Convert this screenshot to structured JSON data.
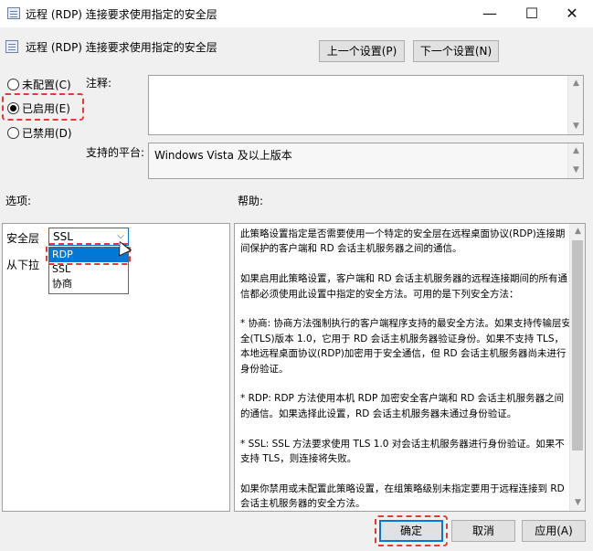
{
  "window": {
    "title": "远程 (RDP) 连接要求使用指定的安全层",
    "minimize": "—",
    "maximize": "☐",
    "close": "✕"
  },
  "policy": {
    "title": "远程 (RDP) 连接要求使用指定的安全层",
    "prev_button": "上一个设置(P)",
    "next_button": "下一个设置(N)"
  },
  "state": {
    "options": [
      {
        "label": "未配置(C)",
        "checked": false
      },
      {
        "label": "已启用(E)",
        "checked": true
      },
      {
        "label": "已禁用(D)",
        "checked": false
      }
    ]
  },
  "comment": {
    "label": "注释:",
    "value": ""
  },
  "platform": {
    "label": "支持的平台:",
    "value": "Windows Vista 及以上版本"
  },
  "options_panel": {
    "header": "选项:",
    "field_label": "安全层",
    "select_value": "SSL",
    "dropdown_options": [
      "RDP",
      "SSL",
      "协商"
    ],
    "highlighted_option": "RDP",
    "truncated_text": "从下拉"
  },
  "help_panel": {
    "header": "帮助:",
    "paragraphs": [
      "此策略设置指定是否需要使用一个特定的安全层在远程桌面协议(RDP)连接期间保护的客户端和 RD 会话主机服务器之间的通信。",
      "如果启用此策略设置，客户端和 RD 会话主机服务器的远程连接期间的所有通信都必须使用此设置中指定的安全方法。可用的是下列安全方法：",
      " * 协商: 协商方法强制执行的客户端程序支持的最安全方法。如果支持传输层安全(TLS)版本 1.0，它用于 RD 会话主机服务器验证身份。如果不支持 TLS，本地远程桌面协议(RDP)加密用于安全通信，但 RD 会话主机服务器尚未进行身份验证。",
      " * RDP: RDP 方法使用本机 RDP 加密安全客户端和 RD 会话主机服务器之间的通信。如果选择此设置，RD 会话主机服务器未通过身份验证。",
      " * SSL: SSL 方法要求使用 TLS 1.0 对会话主机服务器进行身份验证。如果不支持 TLS，则连接将失败。",
      "如果你禁用或未配置此策略设置，在组策略级别未指定要用于远程连接到 RD 会话主机服务器的安全方法。"
    ]
  },
  "footer": {
    "ok": "确定",
    "cancel": "取消",
    "apply": "应用(A)"
  }
}
